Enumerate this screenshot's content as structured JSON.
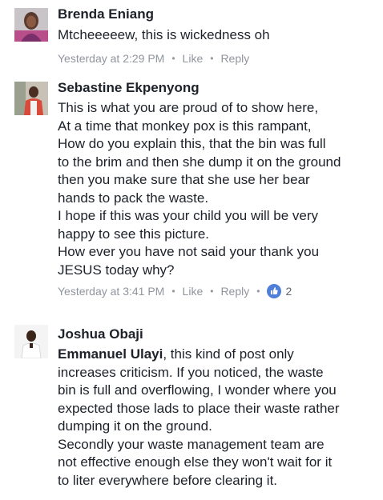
{
  "comments": [
    {
      "author": "Brenda Eniang",
      "lines": [
        "Mtcheeeeew,  this is wickedness oh"
      ],
      "time": "Yesterday at 2:29 PM",
      "like_label": "Like",
      "reply_label": "Reply",
      "avatar_icon": "profile-photo-woman"
    },
    {
      "author": "Sebastine Ekpenyong",
      "lines": [
        "This is what you are proud of to show here,",
        "At a time that monkey pox is this rampant,",
        "How do you explain this, that the bin was full",
        "to the brim and then she dump it on the ground",
        "then you make sure that she use her bear",
        "hands to pack the waste.",
        "I hope if this was your child you will be very",
        "happy to see this picture.",
        "How ever you have not said your thank you",
        "JESUS today why?"
      ],
      "time": "Yesterday at 3:41 PM",
      "like_label": "Like",
      "reply_label": "Reply",
      "reaction_icon": "thumbs-up-icon",
      "reaction_count": "2",
      "avatar_icon": "profile-photo-man"
    },
    {
      "author": "Joshua Obaji",
      "mention": "Emmanuel Ulayi",
      "first_line_rest": ", this kind of post only",
      "lines": [
        "increases criticism. If you noticed, the waste",
        "bin is full and overflowing, I wonder where you",
        "expected those lads to place their waste rather",
        "dumping it on the ground.",
        "Secondly your waste management team are",
        "not effective enough else they won't wait for it",
        "to liter everywhere before clearing it."
      ],
      "avatar_icon": "profile-photo-man-white-shirt"
    }
  ],
  "colors": {
    "name": "#1d2129",
    "meta": "#90949c",
    "like_badge": "#4f7fd8"
  }
}
